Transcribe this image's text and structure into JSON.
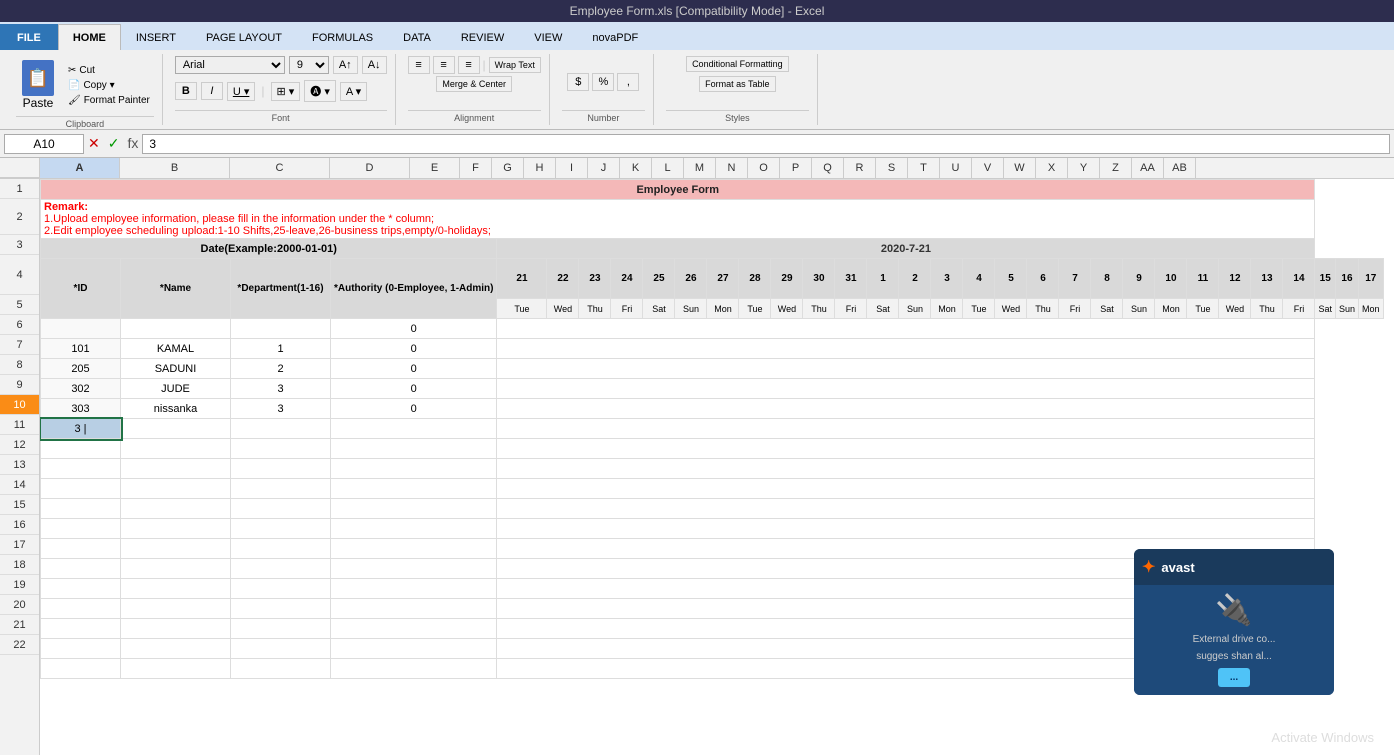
{
  "titleBar": {
    "title": "Employee Form.xls [Compatibility Mode] - Excel"
  },
  "ribbon": {
    "tabs": [
      "FILE",
      "HOME",
      "INSERT",
      "PAGE LAYOUT",
      "FORMULAS",
      "DATA",
      "REVIEW",
      "VIEW",
      "novaPDF"
    ],
    "activeTab": "HOME",
    "clipboard": {
      "paste": "Paste",
      "cut": "✂ Cut",
      "copy": "📋 Copy",
      "formatPainter": "🖌 Format Painter",
      "groupLabel": "Clipboard"
    },
    "font": {
      "name": "Arial",
      "size": "9",
      "groupLabel": "Font"
    },
    "alignment": {
      "wrapText": "Wrap Text",
      "mergeCenter": "Merge & Center",
      "groupLabel": "Alignment"
    },
    "number": {
      "dollar": "$",
      "percent": "%",
      "groupLabel": "Number"
    },
    "styles": {
      "conditional": "Conditional Formatting",
      "formatTable": "Format as Table",
      "groupLabel": "Styles"
    }
  },
  "formulaBar": {
    "cellRef": "A10",
    "formula": "3"
  },
  "sheet": {
    "title": "Employee Form",
    "remark": {
      "line1": "Remark:",
      "line2": "1.Upload employee information, please fill in the information under the * column;",
      "line3": "2.Edit employee scheduling upload:1-10 Shifts,25-leave,26-business trips,empty/0-holidays;"
    },
    "dateLabel": "Date(Example:2000-01-01)",
    "dateValue": "2020-7-21",
    "headers": {
      "id": "*ID",
      "name": "*Name",
      "department": "*Department(1-16)",
      "authority": "*Authority (0-Employee, 1-Admin)"
    },
    "days": [
      "21",
      "22",
      "23",
      "24",
      "25",
      "26",
      "27",
      "28",
      "29",
      "30",
      "31",
      "1",
      "2",
      "3",
      "4",
      "5",
      "6",
      "7",
      "8",
      "9",
      "10",
      "11",
      "12",
      "13",
      "14",
      "15",
      "16",
      "17"
    ],
    "dayLabels": [
      "Tue",
      "Wed",
      "Thu",
      "Fri",
      "Sat",
      "Sun",
      "Mon",
      "Tue",
      "Wed",
      "Thu",
      "Fri",
      "Sat",
      "Sun",
      "Mon",
      "Tue",
      "Wed",
      "Thu",
      "Fri",
      "Sat",
      "Sun",
      "Mon",
      "Tue",
      "Wed",
      "Thu",
      "Fri",
      "Sat",
      "Sun",
      "Mon"
    ],
    "employees": [
      {
        "id": "101",
        "name": "KAMAL",
        "dept": "1",
        "auth": "0"
      },
      {
        "id": "205",
        "name": "SADUNI",
        "dept": "2",
        "auth": "0"
      },
      {
        "id": "302",
        "name": "JUDE",
        "dept": "3",
        "auth": "0"
      },
      {
        "id": "303",
        "name": "nissanka",
        "dept": "3",
        "auth": "0"
      }
    ],
    "activeCell": "3",
    "activeCellRow": 10
  },
  "avast": {
    "title": "avast",
    "subtitle": "External drive co...",
    "body": "sugges shan al...",
    "buttonLabel": "..."
  },
  "windowsActivate": "Activate Windows"
}
